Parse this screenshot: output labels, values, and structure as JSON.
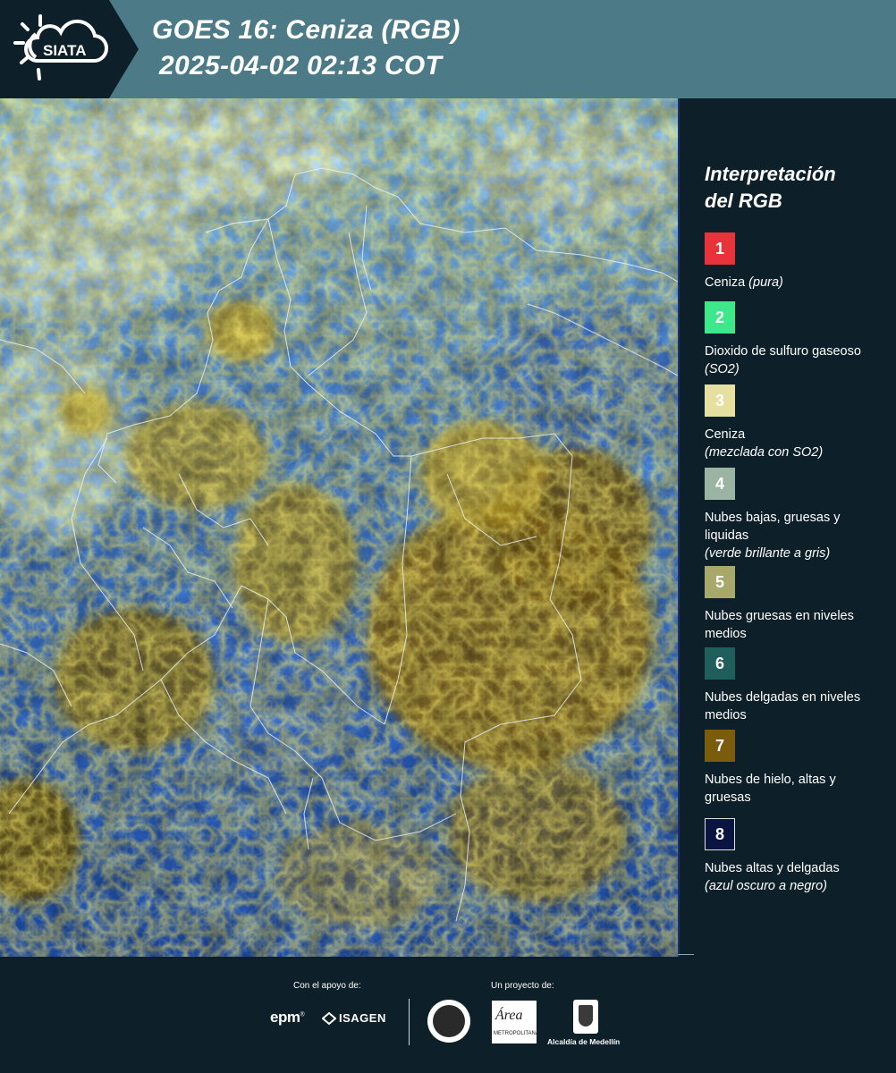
{
  "header": {
    "logo_text": "SIATA",
    "title_line1": "GOES 16: Ceniza (RGB)",
    "title_line2": "2025-04-02 02:13 COT"
  },
  "legend": {
    "title_line1": "Interpretación",
    "title_line2": "del RGB",
    "items": [
      {
        "number": "1",
        "color": "#e8333a",
        "text": "Ceniza",
        "italic": "(pura)"
      },
      {
        "number": "2",
        "color": "#3de88a",
        "text": "Dioxido de sulfuro gaseoso",
        "italic": "(SO2)"
      },
      {
        "number": "3",
        "color": "#e6e0a0",
        "text": "Ceniza",
        "italic": "(mezclada con SO2)"
      },
      {
        "number": "4",
        "color": "#9bb3a3",
        "text": "Nubes bajas, gruesas y liquidas",
        "italic": "(verde brillante a gris)"
      },
      {
        "number": "5",
        "color": "#a8a86a",
        "text": "Nubes gruesas en niveles medios",
        "italic": ""
      },
      {
        "number": "6",
        "color": "#1f5e5a",
        "text": "Nubes delgadas en niveles medios",
        "italic": ""
      },
      {
        "number": "7",
        "color": "#7a5c0c",
        "text": "Nubes de hielo, altas y gruesas",
        "italic": ""
      },
      {
        "number": "8",
        "color": "#0a1440",
        "text": "Nubes altas y delgadas",
        "italic": "(azul oscuro a negro)"
      }
    ]
  },
  "footer": {
    "support_label": "Con el apoyo de:",
    "project_label": "Un proyecto de:",
    "epm": "epm",
    "isagen": "ISAGEN",
    "area_text": "Área",
    "area_sub": "METROPOLITANA",
    "alcaldia": "Alcaldía de Medellín"
  }
}
